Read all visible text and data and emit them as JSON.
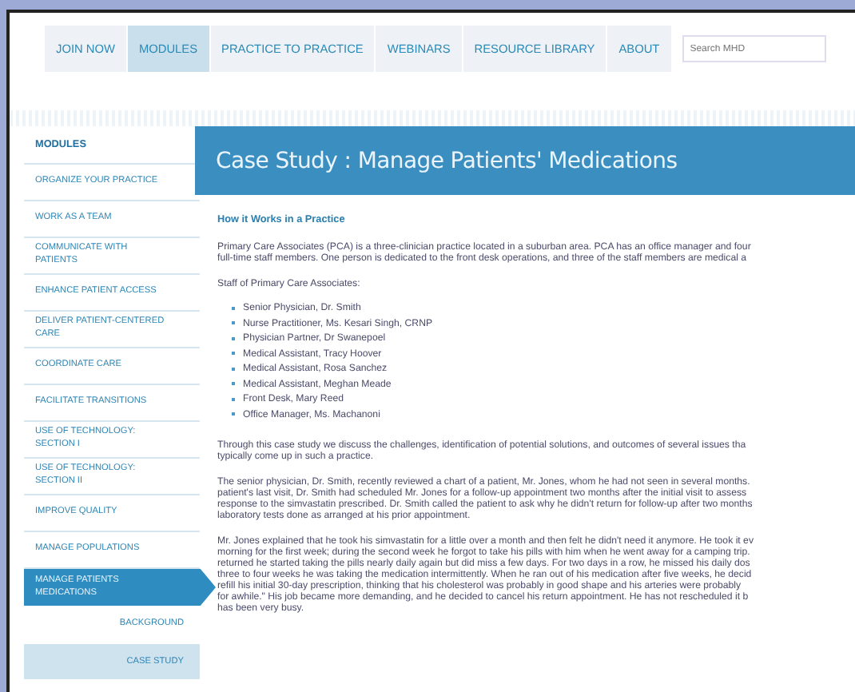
{
  "nav": {
    "items": [
      {
        "label": "JOIN NOW",
        "selected": false
      },
      {
        "label": "MODULES",
        "selected": true
      },
      {
        "label": "PRACTICE TO PRACTICE",
        "selected": false
      },
      {
        "label": "WEBINARS",
        "selected": false
      },
      {
        "label": "RESOURCE LIBRARY",
        "selected": false
      },
      {
        "label": "ABOUT",
        "selected": false
      }
    ],
    "search": {
      "placeholder": "Search MHD"
    }
  },
  "sidebar": {
    "heading": "MODULES",
    "items": [
      {
        "label": "ORGANIZE YOUR PRACTICE",
        "selected": false
      },
      {
        "label": "WORK AS A TEAM",
        "selected": false
      },
      {
        "label": "COMMUNICATE WITH PATIENTS",
        "selected": false
      },
      {
        "label": "ENHANCE PATIENT ACCESS",
        "selected": false
      },
      {
        "label": "DELIVER PATIENT-CENTERED CARE",
        "selected": false
      },
      {
        "label": "COORDINATE CARE",
        "selected": false
      },
      {
        "label": "FACILITATE TRANSITIONS",
        "selected": false
      },
      {
        "label": "USE OF TECHNOLOGY: SECTION I",
        "selected": false
      },
      {
        "label": "USE OF TECHNOLOGY: SECTION II",
        "selected": false
      },
      {
        "label": "IMPROVE QUALITY",
        "selected": false
      },
      {
        "label": "MANAGE POPULATIONS",
        "selected": false
      },
      {
        "label": "MANAGE PATIENTS MEDICATIONS",
        "selected": true,
        "children": [
          {
            "label": "BACKGROUND",
            "selected": false
          },
          {
            "label": "CASE STUDY",
            "selected": true
          }
        ]
      }
    ]
  },
  "content": {
    "title": "Case Study : Manage Patients' Medications",
    "heading": "How it Works in a Practice",
    "blocks": [
      {
        "kind": "paragraph",
        "lines": [
          "Primary Care Associates (PCA) is a three-clinician practice located in a suburban area. PCA has an office manager and four",
          "full-time staff members. One person is dedicated to the front desk operations, and three of the staff members are medical a"
        ]
      },
      {
        "kind": "paragraph",
        "lines": [
          "Staff of Primary Care Associates:"
        ]
      },
      {
        "kind": "list",
        "items": [
          "Senior Physician, Dr. Smith",
          "Nurse Practitioner, Ms. Kesari Singh, CRNP",
          "Physician Partner, Dr Swanepoel",
          "Medical Assistant, Tracy Hoover",
          "Medical Assistant, Rosa Sanchez",
          "Medical Assistant, Meghan Meade",
          "Front Desk, Mary Reed",
          "Office Manager, Ms. Machanoni"
        ]
      },
      {
        "kind": "paragraph",
        "lines": [
          "Through this case study we discuss the challenges, identification of potential solutions, and outcomes of several issues tha",
          "typically come up in such a practice."
        ]
      },
      {
        "kind": "paragraph",
        "lines": [
          "The senior physician, Dr. Smith, recently reviewed a chart of a patient, Mr. Jones, whom he had not seen in several months.",
          "patient's last visit, Dr. Smith had scheduled Mr. Jones for a follow-up appointment two months after the initial visit to assess",
          "response to the simvastatin prescribed. Dr. Smith called the patient to ask why he didn't return for follow-up after two months",
          "laboratory tests done as arranged at his prior appointment."
        ]
      },
      {
        "kind": "paragraph",
        "lines": [
          "Mr. Jones explained that he took his simvastatin for a little over a month and then felt he didn't need it anymore. He took it ev",
          "morning for the first week; during the second week he forgot to take his pills with him when he went away for a camping trip.",
          "returned he started taking the pills nearly daily again but did miss a few days. For two days in a row, he missed his daily dos",
          "three to four weeks he was taking the medication intermittently. When he ran out of his medication after five weeks, he decid",
          "refill his initial 30-day prescription, thinking that his cholesterol was probably in good shape and his arteries were probably",
          "for awhile.\" His job became more demanding, and he decided to cancel his return appointment. He has not rescheduled it b",
          "has been very busy."
        ]
      }
    ]
  }
}
